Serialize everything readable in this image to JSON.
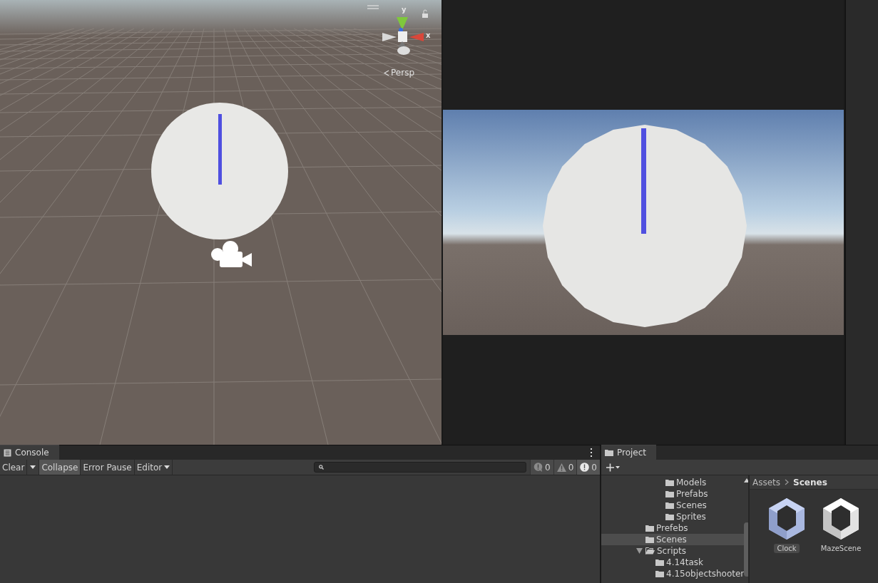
{
  "scene_view": {
    "gizmo": {
      "y_label": "y",
      "x_label": "x"
    },
    "projection": "Persp"
  },
  "console": {
    "tab": "Console",
    "toolbar": [
      {
        "label": "Clear",
        "kind": "button",
        "selected": false
      },
      {
        "label": "Collapse",
        "kind": "toggle",
        "selected": true
      },
      {
        "label": "Error Pause",
        "kind": "toggle",
        "selected": false
      },
      {
        "label": "Editor",
        "kind": "dropdown",
        "selected": false
      }
    ],
    "counters": [
      {
        "kind": "info",
        "count": "0"
      },
      {
        "kind": "warning",
        "count": "0"
      },
      {
        "kind": "error",
        "count": "0"
      }
    ]
  },
  "project": {
    "tab": "Project",
    "breadcrumb": [
      "Assets",
      "Scenes"
    ],
    "tree": [
      {
        "children": [
          {
            "label": "Models",
            "selected": false
          },
          {
            "label": "Prefabs",
            "selected": false
          },
          {
            "label": "Scenes",
            "selected": false
          },
          {
            "label": "Sprites",
            "selected": false
          }
        ]
      },
      {
        "label": "Prefebs",
        "selected": false
      },
      {
        "label": "Scenes",
        "selected": true
      },
      {
        "label": "Scripts",
        "selected": false,
        "expanded": true,
        "children": [
          {
            "label": "4.14task",
            "selected": false
          },
          {
            "label": "4.15objectshooter",
            "selected": false
          }
        ]
      }
    ],
    "assets": [
      {
        "label": "Clock",
        "selected": true
      },
      {
        "label": "MazeScene",
        "selected": false
      }
    ]
  }
}
